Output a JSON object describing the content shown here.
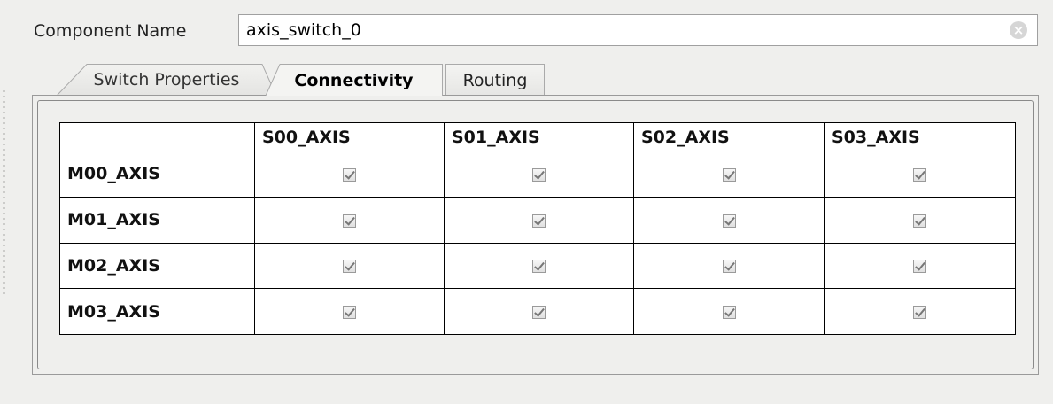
{
  "component": {
    "label": "Component Name",
    "value": "axis_switch_0"
  },
  "tabs": [
    {
      "label": "Switch Properties",
      "active": false
    },
    {
      "label": "Connectivity",
      "active": true
    },
    {
      "label": "Routing",
      "active": false
    }
  ],
  "matrix": {
    "columns": [
      "S00_AXIS",
      "S01_AXIS",
      "S02_AXIS",
      "S03_AXIS"
    ],
    "rows": [
      {
        "label": "M00_AXIS",
        "checked": [
          true,
          true,
          true,
          true
        ]
      },
      {
        "label": "M01_AXIS",
        "checked": [
          true,
          true,
          true,
          true
        ]
      },
      {
        "label": "M02_AXIS",
        "checked": [
          true,
          true,
          true,
          true
        ]
      },
      {
        "label": "M03_AXIS",
        "checked": [
          true,
          true,
          true,
          true
        ]
      }
    ]
  },
  "icons": {
    "clear": "clear-icon"
  }
}
